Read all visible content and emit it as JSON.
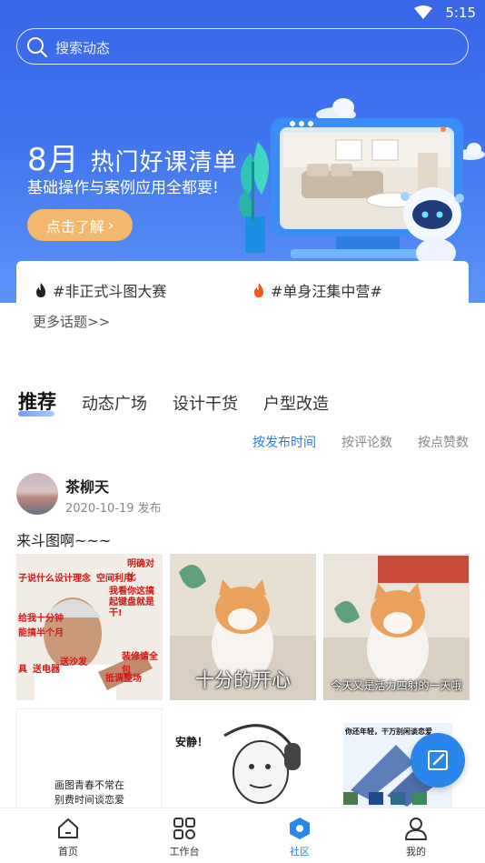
{
  "status_bar": {
    "time": "5:15"
  },
  "search": {
    "placeholder": "搜索动态"
  },
  "banner": {
    "title_big": "8月",
    "title_rest": "热门好课清单",
    "subtitle": "基础操作与案例应用全都要!",
    "button_label": "点击了解",
    "button_arrow": "›"
  },
  "topics": {
    "items": [
      {
        "label": "#非正式斗图大赛",
        "icon": "fire-icon",
        "color": "#222222"
      },
      {
        "label": "#单身汪集中营#",
        "icon": "fire-icon",
        "color": "#f05a1e"
      }
    ],
    "more": "更多话题>>"
  },
  "tabs": [
    "推荐",
    "动态广场",
    "设计干货",
    "户型改造"
  ],
  "sort_options": [
    "按发布时间",
    "按评论数",
    "按点赞数"
  ],
  "post": {
    "author": "茶柳天",
    "date": "2020-10-19 发布",
    "text": "来斗图啊~~~",
    "images": [
      {
        "caption": "",
        "meme_lines": [
          "子说什么设计理念",
          "空间利用",
          "明确对比",
          "给我十分钟",
          "能搞半个月",
          "我看你这搞起键盘就是干!",
          "具",
          "送电器",
          "送沙发",
          "装修请全包",
          "抵调整场"
        ]
      },
      {
        "caption": "十分的开心"
      },
      {
        "caption": "今天又是活力四射的一天哦"
      },
      {
        "caption": "",
        "text_lines": [
          "画图青春不常在",
          "别费时间谈恋爱"
        ]
      },
      {
        "caption": "",
        "label": "安静！"
      },
      {
        "caption": "",
        "label": "你还年轻，干万别闲谈恋爱"
      }
    ]
  },
  "nav": [
    {
      "label": "首页",
      "icon": "home-icon"
    },
    {
      "label": "工作台",
      "icon": "workbench-icon"
    },
    {
      "label": "社区",
      "icon": "community-icon"
    },
    {
      "label": "我的",
      "icon": "profile-icon"
    }
  ],
  "colors": {
    "brand_blue": "#2b86ec",
    "banner_blue": "#3f74ef",
    "button_orange": "#f2b86e"
  }
}
